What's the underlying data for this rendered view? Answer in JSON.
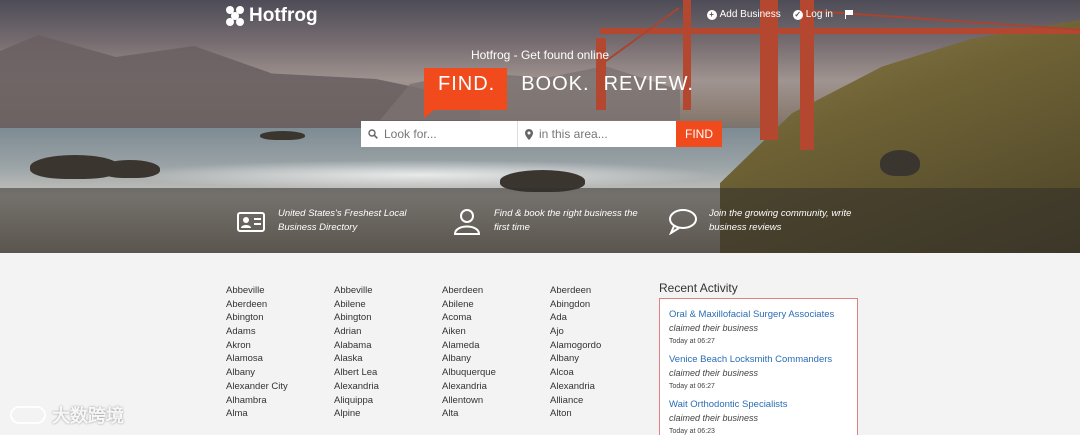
{
  "header": {
    "logo_text": "Hotfrog",
    "add_business": "Add Business",
    "login": "Log in"
  },
  "hero": {
    "tagline": "Hotfrog - Get found online",
    "find_word": "FIND.",
    "book_word": "BOOK.",
    "review_word": "REVIEW."
  },
  "search": {
    "what_placeholder": "Look for...",
    "where_placeholder": "in this area...",
    "button_label": "FIND"
  },
  "features": [
    {
      "line1": "United States's Freshest Local",
      "line2": "Business Directory",
      "icon": "id-card-icon"
    },
    {
      "line1": "Find & book the right business the",
      "line2": "first time",
      "icon": "user-icon"
    },
    {
      "line1": "Join the growing community, write",
      "line2": "business reviews",
      "icon": "chat-bubble-icon"
    }
  ],
  "cities": [
    [
      "Abbeville",
      "Aberdeen",
      "Abington",
      "Adams",
      "Akron",
      "Alamosa",
      "Albany",
      "Alexander City",
      "Alhambra",
      "Alma"
    ],
    [
      "Abbeville",
      "Abilene",
      "Abington",
      "Adrian",
      "Alabama",
      "Alaska",
      "Albert Lea",
      "Alexandria",
      "Aliquippa",
      "Alpine"
    ],
    [
      "Aberdeen",
      "Abilene",
      "Acoma",
      "Aiken",
      "Alameda",
      "Albany",
      "Albuquerque",
      "Alexandria",
      "Allentown",
      "Alta"
    ],
    [
      "Aberdeen",
      "Abingdon",
      "Ada",
      "Ajo",
      "Alamogordo",
      "Albany",
      "Alcoa",
      "Alexandria",
      "Alliance",
      "Alton"
    ]
  ],
  "recent": {
    "title": "Recent Activity",
    "items": [
      {
        "name": "Oral & Maxillofacial Surgery Associates",
        "action": "claimed their business",
        "time": "Today at 06:27"
      },
      {
        "name": "Venice Beach Locksmith Commanders",
        "action": "claimed their business",
        "time": "Today at 06:27"
      },
      {
        "name": "Wait Orthodontic Specialists",
        "action": "claimed their business",
        "time": "Today at 06:23"
      }
    ]
  },
  "watermark": "大数跨境",
  "colors": {
    "accent": "#f04a1d",
    "link": "#2a6db5",
    "box_border": "#e08080"
  }
}
